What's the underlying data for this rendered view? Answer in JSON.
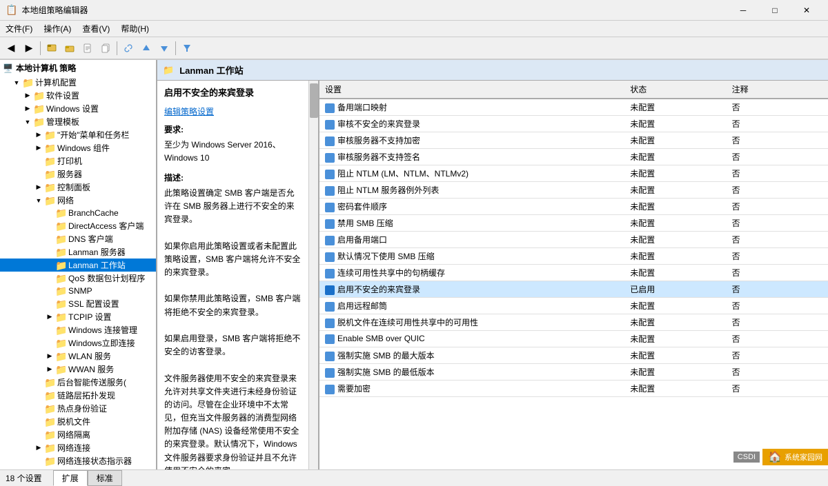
{
  "titleBar": {
    "icon": "📋",
    "title": "本地组策略编辑器",
    "minBtn": "─",
    "maxBtn": "□",
    "closeBtn": "✕"
  },
  "menuBar": {
    "items": [
      "文件(F)",
      "操作(A)",
      "查看(V)",
      "帮助(H)"
    ]
  },
  "toolbar": {
    "buttons": [
      "◀",
      "▶",
      "⬆",
      "📂",
      "📄",
      "📋",
      "🔍",
      "⬆",
      "⬇",
      "▽"
    ]
  },
  "tree": {
    "rootLabel": "本地计算机 策略",
    "nodes": [
      {
        "id": "computer",
        "label": "计算机配置",
        "level": 1,
        "expanded": true,
        "hasChildren": true
      },
      {
        "id": "software",
        "label": "软件设置",
        "level": 2,
        "expanded": false,
        "hasChildren": true
      },
      {
        "id": "windows",
        "label": "Windows 设置",
        "level": 2,
        "expanded": false,
        "hasChildren": true
      },
      {
        "id": "admin",
        "label": "管理模板",
        "level": 2,
        "expanded": true,
        "hasChildren": true
      },
      {
        "id": "startmenu",
        "label": "\"开始\"菜单和任务栏",
        "level": 3,
        "expanded": false,
        "hasChildren": true
      },
      {
        "id": "wincomp",
        "label": "Windows 组件",
        "level": 3,
        "expanded": false,
        "hasChildren": true
      },
      {
        "id": "printer",
        "label": "打印机",
        "level": 3,
        "expanded": false,
        "hasChildren": false
      },
      {
        "id": "server",
        "label": "服务器",
        "level": 3,
        "expanded": false,
        "hasChildren": false
      },
      {
        "id": "control",
        "label": "控制面板",
        "level": 3,
        "expanded": false,
        "hasChildren": true
      },
      {
        "id": "network",
        "label": "网络",
        "level": 3,
        "expanded": true,
        "hasChildren": true
      },
      {
        "id": "branchcache",
        "label": "BranchCache",
        "level": 4,
        "expanded": false,
        "hasChildren": false
      },
      {
        "id": "directaccess",
        "label": "DirectAccess 客户端",
        "level": 4,
        "expanded": false,
        "hasChildren": false
      },
      {
        "id": "dns",
        "label": "DNS 客户端",
        "level": 4,
        "expanded": false,
        "hasChildren": false
      },
      {
        "id": "lanmanserver",
        "label": "Lanman 服务器",
        "level": 4,
        "expanded": false,
        "hasChildren": false
      },
      {
        "id": "lanmanworkstation",
        "label": "Lanman 工作站",
        "level": 4,
        "expanded": false,
        "hasChildren": false,
        "selected": true
      },
      {
        "id": "qos",
        "label": "QoS 数据包计划程序",
        "level": 4,
        "expanded": false,
        "hasChildren": false
      },
      {
        "id": "snmp",
        "label": "SNMP",
        "level": 4,
        "expanded": false,
        "hasChildren": false
      },
      {
        "id": "ssl",
        "label": "SSL 配置设置",
        "level": 4,
        "expanded": false,
        "hasChildren": false
      },
      {
        "id": "tcpip",
        "label": "TCPIP 设置",
        "level": 4,
        "expanded": false,
        "hasChildren": true
      },
      {
        "id": "winconn",
        "label": "Windows 连接管理",
        "level": 4,
        "expanded": false,
        "hasChildren": false
      },
      {
        "id": "wininstant",
        "label": "Windows立即连接",
        "level": 4,
        "expanded": false,
        "hasChildren": false
      },
      {
        "id": "wlan",
        "label": "WLAN 服务",
        "level": 4,
        "expanded": false,
        "hasChildren": true
      },
      {
        "id": "wwan",
        "label": "WWAN 服务",
        "level": 4,
        "expanded": false,
        "hasChildren": true
      },
      {
        "id": "bgdeliver",
        "label": "后台智能传送服务(",
        "level": 3,
        "expanded": false,
        "hasChildren": false
      },
      {
        "id": "linktopo",
        "label": "链路层拓扑发现",
        "level": 3,
        "expanded": false,
        "hasChildren": false
      },
      {
        "id": "hotspot",
        "label": "热点身份验证",
        "level": 3,
        "expanded": false,
        "hasChildren": false
      },
      {
        "id": "offline",
        "label": "脱机文件",
        "level": 3,
        "expanded": false,
        "hasChildren": false
      },
      {
        "id": "isolation",
        "label": "网络隔离",
        "level": 3,
        "expanded": false,
        "hasChildren": false
      },
      {
        "id": "netconn",
        "label": "网络连接",
        "level": 3,
        "expanded": false,
        "hasChildren": true
      },
      {
        "id": "netstat",
        "label": "网络连接状态指示器",
        "level": 3,
        "expanded": false,
        "hasChildren": false
      }
    ]
  },
  "rightHeader": {
    "icon": "📁",
    "label": "Lanman 工作站"
  },
  "descPanel": {
    "title": "启用不安全的来宾登录",
    "linkText": "编辑策略设置",
    "requireLabel": "要求:",
    "requireText": "至少为 Windows Server 2016、Windows 10",
    "descLabel": "描述:",
    "descText": "此策略设置确定 SMB 客户端是否允许在 SMB 服务器上进行不安全的来宾登录。\n\n如果你启用此策略设置或者未配置此策略设置，SMB 客户端将允许不安全的来宾登录。\n\n如果你禁用此策略设置，SMB 客户端将拒绝不安全的来宾登录。\n\n如果启用登录，SMB 客户端将拒绝不安全的访客登录。\n\n文件服务器使用不安全的来宾登录来允许对共享文件夹进行未经身份验证的访问。尽管在企业环境中不太常见，但充当文件服务器的消费型网络附加存储 (NAS) 设备经常使用不安全的来宾登录。默认情况下，Windows 文件服务器要求身份验证并且不允许使用不安全的来宾"
  },
  "settingsTable": {
    "columns": [
      "设置",
      "状态",
      "注释"
    ],
    "rows": [
      {
        "name": "备用端口映射",
        "status": "未配置",
        "comment": "否",
        "highlighted": false
      },
      {
        "name": "审核不安全的来宾登录",
        "status": "未配置",
        "comment": "否",
        "highlighted": false
      },
      {
        "name": "审核服务器不支持加密",
        "status": "未配置",
        "comment": "否",
        "highlighted": false
      },
      {
        "name": "审核服务器不支持签名",
        "status": "未配置",
        "comment": "否",
        "highlighted": false
      },
      {
        "name": "阻止 NTLM (LM、NTLM、NTLMv2)",
        "status": "未配置",
        "comment": "否",
        "highlighted": false
      },
      {
        "name": "阻止 NTLM 服务器例外列表",
        "status": "未配置",
        "comment": "否",
        "highlighted": false
      },
      {
        "name": "密码套件顺序",
        "status": "未配置",
        "comment": "否",
        "highlighted": false
      },
      {
        "name": "禁用 SMB 压缩",
        "status": "未配置",
        "comment": "否",
        "highlighted": false
      },
      {
        "name": "启用备用端口",
        "status": "未配置",
        "comment": "否",
        "highlighted": false
      },
      {
        "name": "默认情况下使用 SMB 压缩",
        "status": "未配置",
        "comment": "否",
        "highlighted": false
      },
      {
        "name": "连续可用性共享中的句柄缓存",
        "status": "未配置",
        "comment": "否",
        "highlighted": false
      },
      {
        "name": "启用不安全的来宾登录",
        "status": "已启用",
        "comment": "否",
        "highlighted": true
      },
      {
        "name": "启用远程邮筒",
        "status": "未配置",
        "comment": "否",
        "highlighted": false
      },
      {
        "name": "脱机文件在连续可用性共享中的可用性",
        "status": "未配置",
        "comment": "否",
        "highlighted": false
      },
      {
        "name": "Enable SMB over QUIC",
        "status": "未配置",
        "comment": "否",
        "highlighted": false
      },
      {
        "name": "强制实施 SMB 的最大版本",
        "status": "未配置",
        "comment": "否",
        "highlighted": false
      },
      {
        "name": "强制实施 SMB 的最低版本",
        "status": "未配置",
        "comment": "否",
        "highlighted": false
      },
      {
        "name": "需要加密",
        "status": "未配置",
        "comment": "否",
        "highlighted": false
      }
    ]
  },
  "statusBar": {
    "count": "18 个设置",
    "tabs": [
      "扩展",
      "标准"
    ]
  }
}
